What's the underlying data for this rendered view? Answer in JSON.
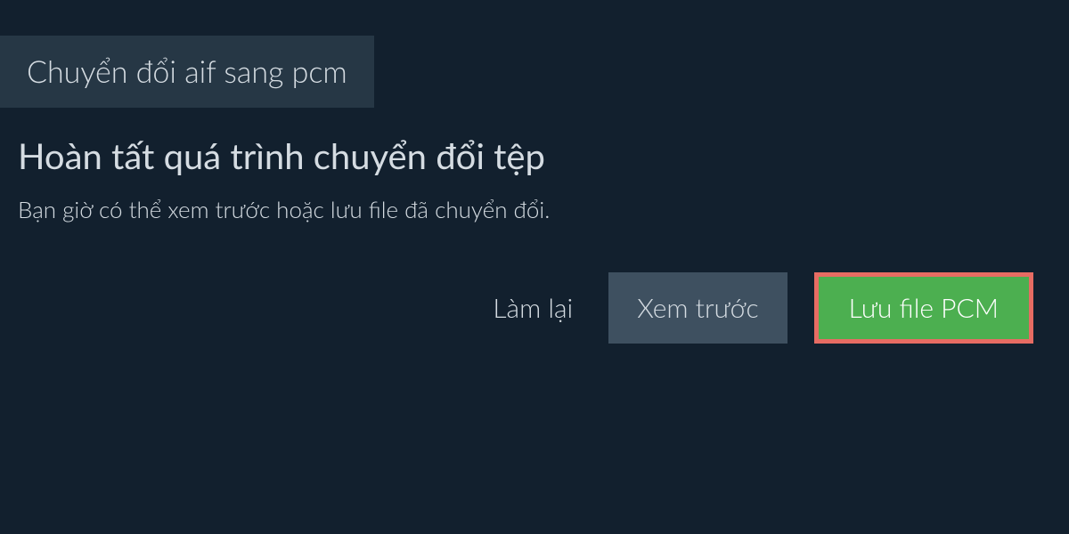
{
  "tab": {
    "label": "Chuyển đổi aif sang pcm"
  },
  "content": {
    "heading": "Hoàn tất quá trình chuyển đổi tệp",
    "description": "Bạn giờ có thể xem trước hoặc lưu file đã chuyển đổi."
  },
  "actions": {
    "redo": "Làm lại",
    "preview": "Xem trước",
    "save": "Lưu file PCM"
  }
}
